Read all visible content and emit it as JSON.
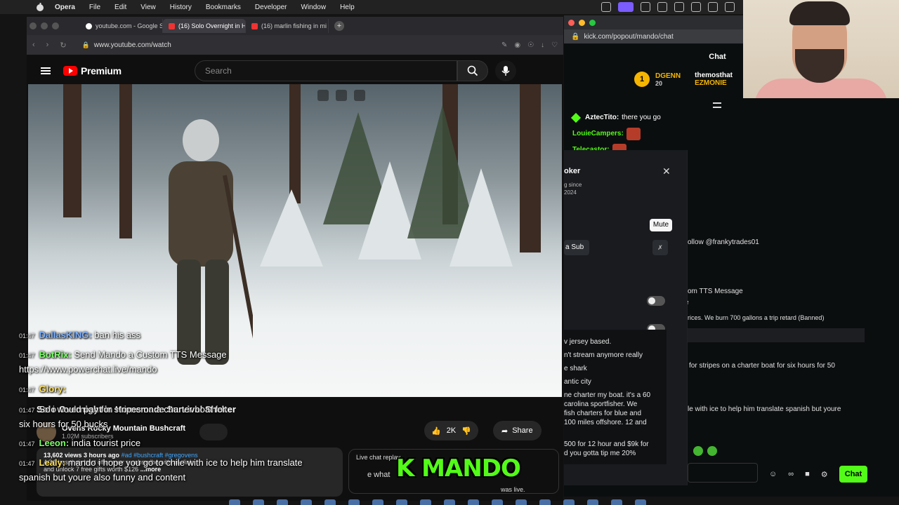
{
  "menubar": {
    "app": "Opera",
    "items": [
      "File",
      "Edit",
      "View",
      "History",
      "Bookmarks",
      "Developer",
      "Window",
      "Help"
    ]
  },
  "browser": {
    "tabs": [
      {
        "label": "youtube.com - Google S"
      },
      {
        "label": "(16) Solo Overnight in H"
      },
      {
        "label": "(16) marlin fishing in mi"
      }
    ],
    "url": "www.youtube.com/watch"
  },
  "youtube": {
    "brand": "Premium",
    "search_placeholder": "Search",
    "video_title": "Solo Overnight in Homemade Survival Shelter",
    "channel_name": "Ovens Rocky Mountain Bushcraft",
    "subscribers": "1.02M subscribers",
    "likes": "2K",
    "share_label": "Share",
    "desc_meta": "13,602 views  3 hours ago",
    "desc_tags": "#ad #bushcraft #gregovens",
    "desc_text": "AG1 has their best offer ever + subscribe with my link",
    "desc_text2": "and unlock 7 free gifts worth $126",
    "more": "...more",
    "live_chat_label": "Live chat replay",
    "live_chat_text": "e what",
    "live_chat_tail": "was live."
  },
  "overlay_chat": [
    {
      "time": "01:47",
      "user": "DallasKING:",
      "color": "blue",
      "text": "ban his ass"
    },
    {
      "time": "01:47",
      "user": "BotRix:",
      "color": "green",
      "text": "Send Mando a Custom TTS Message"
    },
    {
      "time": "",
      "user": "",
      "color": "",
      "text": "https://www.powerchat.live/mando"
    },
    {
      "time": "01:47",
      "user": "Glory:",
      "color": "yellow",
      "text": ""
    },
    {
      "time": "01:47",
      "user": "",
      "color": "",
      "text": "So i would pay for stripes on a charter boat for"
    },
    {
      "time": "",
      "user": "",
      "color": "",
      "text": "six hours for 50 bucks"
    },
    {
      "time": "01:47",
      "user": "Leeon:",
      "color": "green",
      "text": "india tourist price"
    },
    {
      "time": "01:47",
      "user": "Lealy:",
      "color": "yellow",
      "text": "mando i hope you go to chile with ice to help him translate"
    },
    {
      "time": "",
      "user": "",
      "color": "",
      "text": "spanish but youre also funny and content"
    }
  ],
  "stream_overlay_logo": "K MANDO",
  "kick": {
    "url": "kick.com/popout/mando/chat",
    "title": "Chat",
    "top_gifter_rank": "1",
    "top_gifters": [
      {
        "name": "DGENN",
        "count": "20"
      },
      {
        "name": "themosthat"
      },
      {
        "name": "EZMONIE"
      }
    ],
    "messages": [
      {
        "user": "AztecTito:",
        "text": "there you go"
      },
      {
        "user": "LouieCampers:",
        "text": ""
      },
      {
        "user": "Telecastor:",
        "text": ""
      }
    ],
    "right_messages": [
      "ollow @frankytrades01",
      "om TTS Message",
      "e",
      "rices. We burn 700 gallons a trip retard (Banned)",
      "for stripes on a charter boat for six hours for 50",
      "le with ice to help him translate spanish but youre"
    ],
    "popup": {
      "name": "oker",
      "since_label": "g since",
      "since_year": "2024",
      "mute_label": "Mute",
      "sub_label": "a Sub",
      "messages": [
        "v jersey based.",
        "n't stream anymore really",
        "e shark",
        "antic city",
        "ne charter my boat. it's a 60",
        "carolina sportfisher. We",
        "fish charters for blue and",
        "100 miles offshore. 12 and",
        "500 for 12 hour and $9k for",
        "d you gotta tip me 20%"
      ]
    },
    "chat_button": "Chat"
  },
  "colors": {
    "kick_green": "#53fc18",
    "youtube_red": "#ff0000"
  }
}
